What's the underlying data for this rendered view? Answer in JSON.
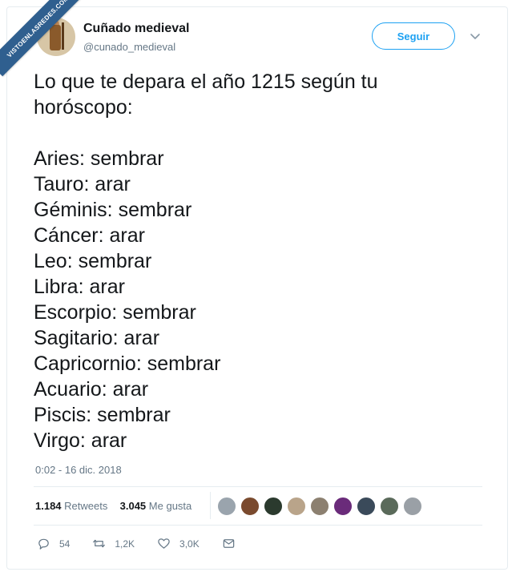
{
  "watermark": "VISTOENLASREDES.COM",
  "author": {
    "name": "Cuñado medieval",
    "handle": "@cunado_medieval"
  },
  "follow_label": "Seguir",
  "tweet": {
    "intro_line1": "Lo que te depara el año 1215 según tu",
    "intro_line2": "horóscopo:",
    "lines": [
      "Aries: sembrar",
      "Tauro: arar",
      "Géminis: sembrar",
      "Cáncer: arar",
      "Leo: sembrar",
      "Libra: arar",
      "Escorpio: sembrar",
      "Sagitario: arar",
      "Capricornio: sembrar",
      "Acuario: arar",
      "Piscis: sembrar",
      "Virgo: arar"
    ]
  },
  "timestamp": "0:02 - 16 dic. 2018",
  "stats": {
    "retweets_count": "1.184",
    "retweets_label": "Retweets",
    "likes_count": "3.045",
    "likes_label": "Me gusta"
  },
  "liker_colors": [
    "#9aa4ad",
    "#7a4a2e",
    "#2b3a2e",
    "#b9a48a",
    "#8c8070",
    "#6a2b7a",
    "#3a4a5a",
    "#5a6a5a",
    "#9aa0a6"
  ],
  "actions": {
    "replies": "54",
    "retweets": "1,2K",
    "likes": "3,0K"
  },
  "icons": [
    "reply-icon",
    "retweet-icon",
    "heart-icon",
    "message-icon",
    "chevron-down-icon"
  ],
  "accent_color": "#1da1f2"
}
